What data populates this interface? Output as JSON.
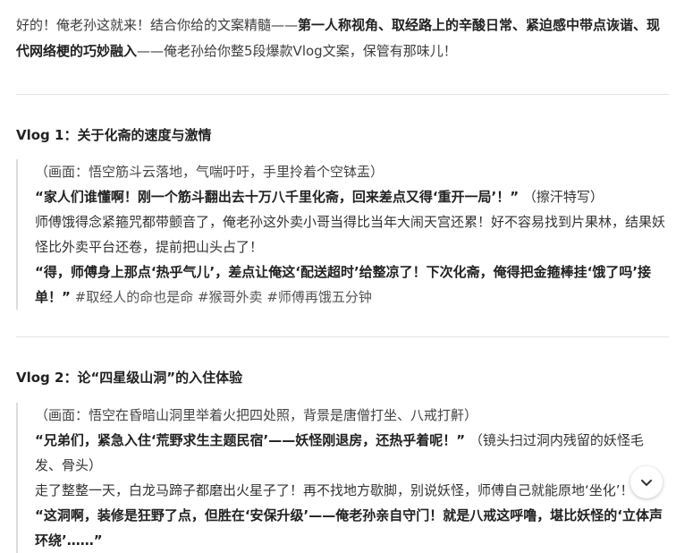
{
  "intro": {
    "part1": "好的！俺老孙这就来！结合你给的文案精髓——",
    "bold": "第一人称视角、取经路上的辛酸日常、紧迫感中带点诙谐、现代网络梗的巧妙融入",
    "part2": "——俺老孙给你整5段爆款Vlog文案，保管有那味儿！"
  },
  "vlog1": {
    "title": "Vlog 1：关于化斋的速度与激情",
    "scene": "（画面：悟空筋斗云落地，气喘吁吁，手里拎着个空钵盂）",
    "line1": "“家人们谁懂啊！刚一个筋斗翻出去十万八千里化斋，回来差点又得‘重开一局’！”",
    "line1_note": "（擦汗特写）",
    "line2": "师傅饿得念紧箍咒都带颤音了，俺老孙这外卖小哥当得比当年大闹天宫还累！好不容易找到片果林，结果妖怪比外卖平台还卷，提前把山头占了！",
    "line3": "“得，师傅身上那点‘热乎气儿’，差点让俺这‘配送超时’给整凉了！下次化斋，俺得把金箍棒挂‘饿了吗’接单！”",
    "tags": "#取经人的命也是命 #猴哥外卖 #师傅再饿五分钟"
  },
  "vlog2": {
    "title": "Vlog 2：论“四星级山洞”的入住体验",
    "scene": "（画面：悟空在昏暗山洞里举着火把四处照，背景是唐僧打坐、八戒打鼾）",
    "line1": "“兄弟们，紧急入住‘荒野求生主题民宿’——妖怪刚退房，还热乎着呢！”",
    "line1_note": "（镜头扫过洞内残留的妖怪毛发、骨头）",
    "line2": "走了整整一天，白龙马蹄子都磨出火星子了！再不找地方歇脚，别说妖怪，师傅自己就能原地‘坐化’！",
    "line3": "“这洞啊，装修是狂野了点，但胜在‘安保升级’——俺老孙亲自守门！就是八戒这呼噜，堪比妖怪的‘立体声环绕’……”"
  }
}
